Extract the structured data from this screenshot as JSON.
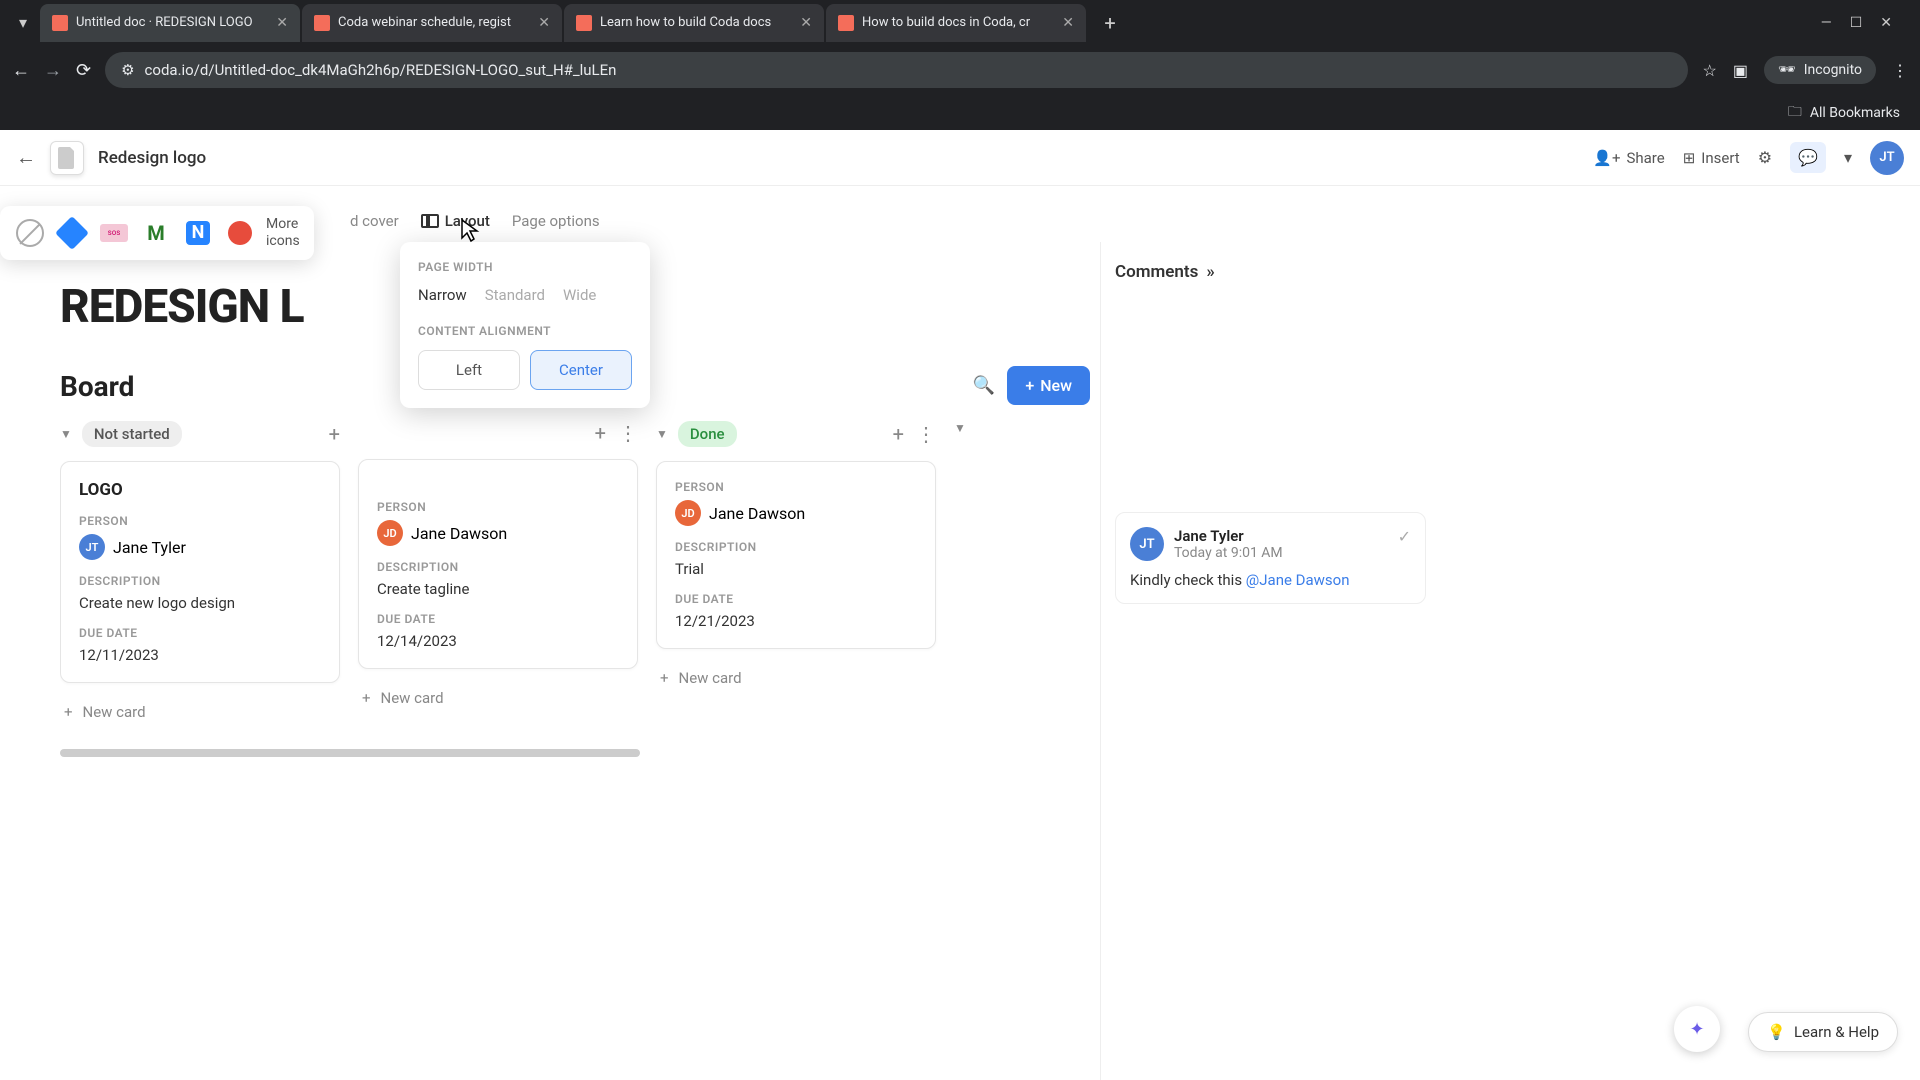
{
  "browser": {
    "tabs": [
      {
        "title": "Untitled doc · REDESIGN LOGO"
      },
      {
        "title": "Coda webinar schedule, regist"
      },
      {
        "title": "Learn how to build Coda docs"
      },
      {
        "title": "How to build docs in Coda, cr"
      }
    ],
    "url": "coda.io/d/Untitled-doc_dk4MaGh2h6p/REDESIGN-LOGO_sut_H#_luLEn",
    "incognito": "Incognito",
    "all_bookmarks": "All Bookmarks"
  },
  "doc": {
    "title": "Redesign logo",
    "actions": {
      "share": "Share",
      "insert": "Insert"
    },
    "user_initials": "JT"
  },
  "icon_picker": {
    "more": "More\nicons"
  },
  "page_toolbar": {
    "cover": "d cover",
    "layout": "Layout",
    "options": "Page options"
  },
  "layout_panel": {
    "width_label": "PAGE WIDTH",
    "narrow": "Narrow",
    "standard": "Standard",
    "wide": "Wide",
    "align_label": "CONTENT ALIGNMENT",
    "left": "Left",
    "center": "Center"
  },
  "page": {
    "title": "REDESIGN L",
    "board_heading": "Board",
    "new_btn": "New",
    "new_card": "New card"
  },
  "labels": {
    "person": "PERSON",
    "description": "DESCRIPTION",
    "due_date": "DUE DATE"
  },
  "columns": [
    {
      "status": "Not started",
      "status_class": "status-grey",
      "cards": [
        {
          "title": "LOGO",
          "person": "Jane Tyler",
          "avatar": "JT",
          "avatar_class": "av-jt",
          "description": "Create new logo design",
          "due": "12/11/2023"
        }
      ]
    },
    {
      "status": "",
      "status_class": "",
      "cards": [
        {
          "title": "",
          "person": "Jane Dawson",
          "avatar": "JD",
          "avatar_class": "av-jd",
          "description": "Create tagline",
          "due": "12/14/2023"
        }
      ]
    },
    {
      "status": "Done",
      "status_class": "status-green",
      "cards": [
        {
          "title": "",
          "person": "Jane Dawson",
          "avatar": "JD",
          "avatar_class": "av-jd",
          "description": "Trial",
          "due": "12/21/2023"
        }
      ]
    }
  ],
  "comments": {
    "header": "Comments",
    "author": "Jane Tyler",
    "author_initials": "JT",
    "time": "Today at 9:01 AM",
    "body_pre": "Kindly check this ",
    "mention": "@Jane Dawson"
  },
  "footer": {
    "learn_help": "Learn & Help"
  }
}
